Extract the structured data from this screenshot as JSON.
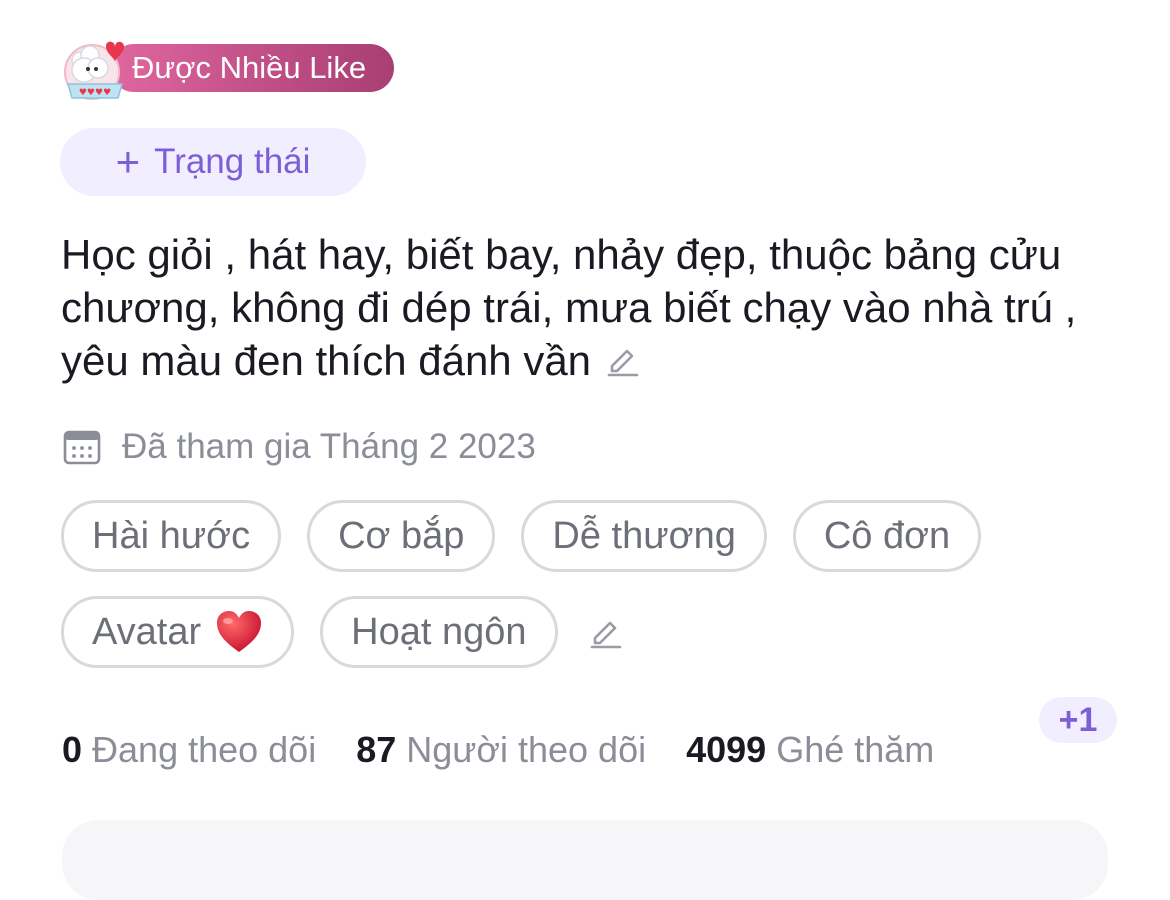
{
  "badge": {
    "label": "Được Nhiều Like",
    "art_icon": "sheep-heart-icon"
  },
  "status_button": {
    "icon": "plus-icon",
    "label": "Trạng thái"
  },
  "bio": {
    "text": "Học giỏi , hát hay, biết bay, nhảy đẹp, thuộc bảng cửu chương, không đi dép trái, mưa biết chạy vào nhà trú , yêu màu đen thích đánh vần",
    "edit_icon": "pencil-icon"
  },
  "joined": {
    "icon": "calendar-icon",
    "text": "Đã tham gia Tháng 2 2023"
  },
  "tags": [
    {
      "label": "Hài hước"
    },
    {
      "label": "Cơ bắp"
    },
    {
      "label": "Dễ thương"
    },
    {
      "label": "Cô đơn"
    },
    {
      "label": "Avatar",
      "emoji_icon": "red-heart-icon"
    },
    {
      "label": "Hoạt ngôn"
    }
  ],
  "tags_edit_icon": "pencil-icon",
  "stats": [
    {
      "value": "0",
      "label": "Đang theo dõi"
    },
    {
      "value": "87",
      "label": "Người theo dõi"
    },
    {
      "value": "4099",
      "label": "Ghé thăm"
    }
  ],
  "visit_increment": "+1",
  "colors": {
    "accent": "#7c5fd6",
    "badge_gradient_start": "#e0679f",
    "badge_gradient_end": "#a83f73"
  }
}
